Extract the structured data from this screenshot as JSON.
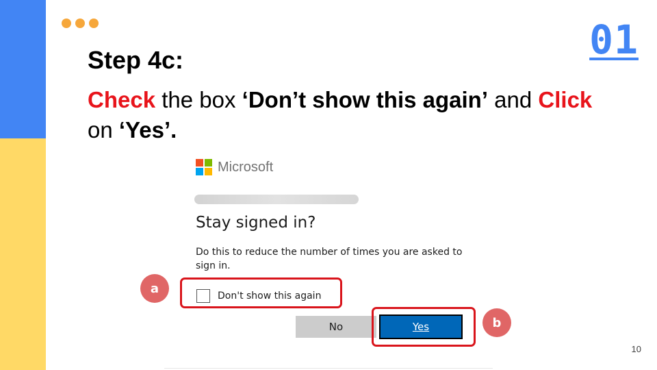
{
  "slide": {
    "step_number": "01",
    "title": "Step 4c:",
    "instruction": {
      "check_word": "Check",
      "text_the_box": " the box ",
      "checkbox_quote": "‘Don’t show this again’",
      "text_and": " and ",
      "click_word": "Click",
      "text_on": "on ",
      "yes_quote": "‘Yes’.",
      "line_break": "\n"
    },
    "page_number": "10"
  },
  "dialog": {
    "brand": "Microsoft",
    "title": "Stay signed in?",
    "body": "Do this to reduce the number of times you are asked to sign in.",
    "checkbox_label": "Don't show this again",
    "checkbox_checked": false,
    "no_button": "No",
    "yes_button": "Yes"
  },
  "annotations": {
    "marker_a": "a",
    "marker_b": "b"
  },
  "colors": {
    "accent_blue": "#4285f4",
    "accent_yellow": "#ffd966",
    "dots_orange": "#f6a73b",
    "emphasis_red": "#e8141b",
    "marker_pink": "#e06666",
    "yes_button_blue": "#0067b8"
  }
}
